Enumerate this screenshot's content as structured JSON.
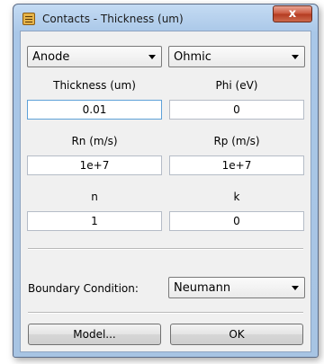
{
  "window": {
    "title": "Contacts - Thickness (um)",
    "close_label": "x"
  },
  "top": {
    "contact_select": "Anode",
    "type_select": "Ohmic"
  },
  "fields": {
    "thickness": {
      "label": "Thickness (um)",
      "value": "0.01"
    },
    "phi": {
      "label": "Phi (eV)",
      "value": "0"
    },
    "rn": {
      "label": "Rn (m/s)",
      "value": "1e+7"
    },
    "rp": {
      "label": "Rp (m/s)",
      "value": "1e+7"
    },
    "n": {
      "label": "n",
      "value": "1"
    },
    "k": {
      "label": "k",
      "value": "0"
    }
  },
  "boundary": {
    "label": "Boundary Condition:",
    "value": "Neumann"
  },
  "buttons": {
    "model": "Model...",
    "ok": "OK"
  }
}
